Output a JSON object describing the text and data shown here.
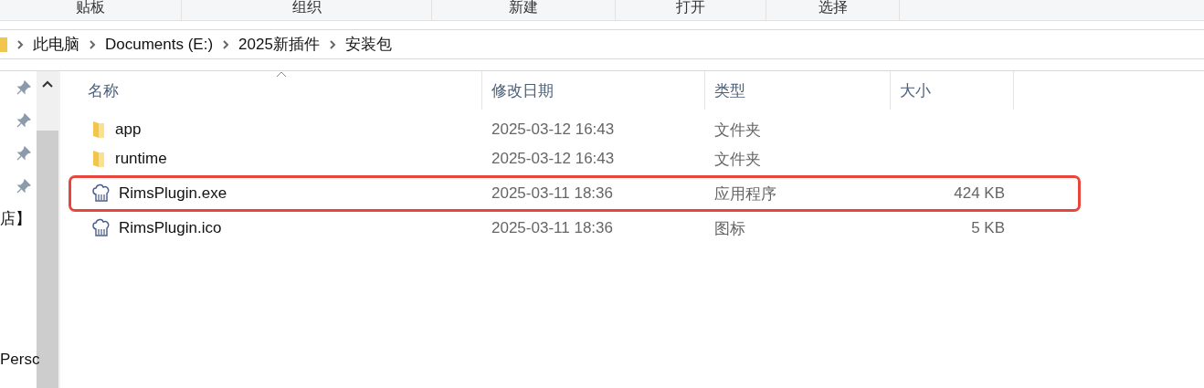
{
  "ribbon": {
    "groups": [
      "贴板",
      "组织",
      "新建",
      "打开",
      "选择"
    ]
  },
  "address_bar": {
    "path": [
      "此电脑",
      "Documents (E:)",
      "2025新插件",
      "安装包"
    ]
  },
  "nav_pane": {
    "items": [
      {
        "pinned": true
      },
      {
        "pinned": true
      },
      {
        "pinned": true
      },
      {
        "pinned": true
      }
    ],
    "labels": [
      "店】",
      "Persc"
    ]
  },
  "table": {
    "columns": [
      "名称",
      "修改日期",
      "类型",
      "大小"
    ],
    "rows": [
      {
        "kind": "folder",
        "name": "app",
        "date": "2025-03-12 16:43",
        "type": "文件夹",
        "highlighted": false
      },
      {
        "kind": "folder",
        "name": "runtime",
        "date": "2025-03-12 16:43",
        "type": "文件夹",
        "highlighted": false
      },
      {
        "kind": "app",
        "name": "RimsPlugin.exe",
        "date": "2025-03-11 18:36",
        "type": "应用程序",
        "size": "424 KB",
        "highlighted": true
      },
      {
        "kind": "app",
        "name": "RimsPlugin.ico",
        "date": "2025-03-11 18:36",
        "type": "图标",
        "size": "5 KB",
        "highlighted": false
      }
    ]
  }
}
